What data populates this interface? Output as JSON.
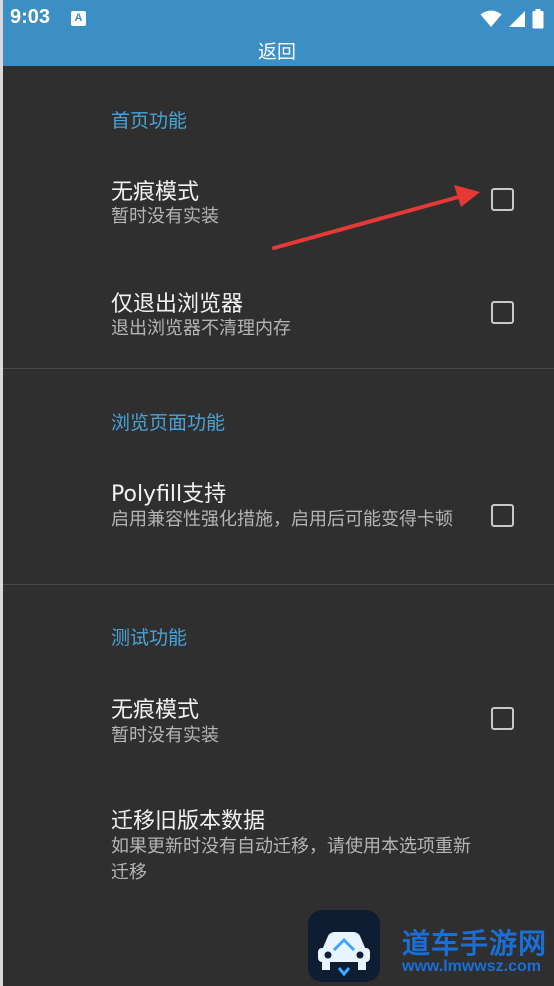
{
  "status_bar": {
    "time": "9:03",
    "app_icon_letter": "A"
  },
  "title_bar": {
    "title": "返回"
  },
  "sections": [
    {
      "header": "首页功能",
      "items": [
        {
          "title": "无痕模式",
          "summary": "暂时没有实装",
          "checked": false
        },
        {
          "title": "仅退出浏览器",
          "summary": "退出浏览器不清理内存",
          "checked": false
        }
      ]
    },
    {
      "header": "浏览页面功能",
      "items": [
        {
          "title": "Polyfill支持",
          "summary": "启用兼容性强化措施，启用后可能变得卡顿",
          "checked": false
        }
      ]
    },
    {
      "header": "测试功能",
      "items": [
        {
          "title": "无痕模式",
          "summary": "暂时没有实装",
          "checked": false
        },
        {
          "title": "迁移旧版本数据",
          "summary": "如果更新时没有自动迁移，请使用本选项重新迁移"
        }
      ]
    }
  ],
  "watermark": {
    "name": "道车手游网",
    "url": "www.lmwwsz.com"
  },
  "colors": {
    "accent": "#3b8fc4",
    "section_header": "#4aa3d6",
    "background": "#2f2f2f",
    "annotation_arrow": "#e53935"
  }
}
